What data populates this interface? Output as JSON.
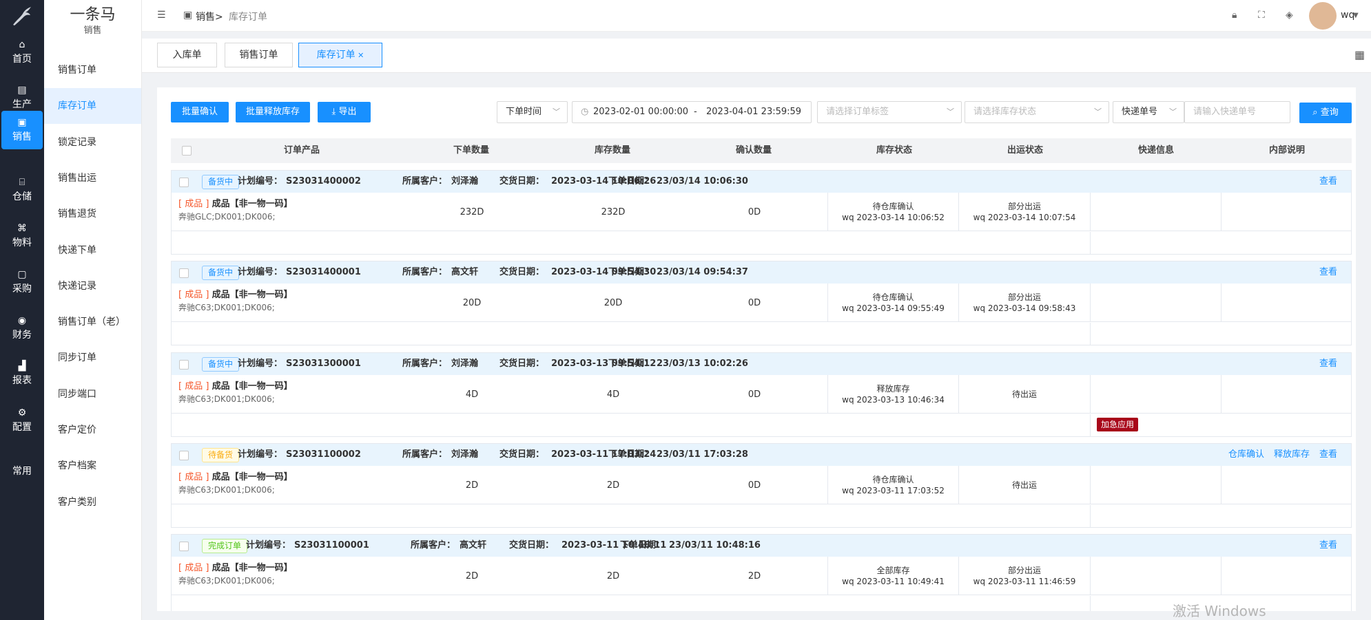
{
  "rail": [
    {
      "icon": "⌂",
      "label": "首页",
      "name": "home"
    },
    {
      "icon": "▤",
      "label": "生产",
      "name": "production"
    },
    {
      "icon": "▣",
      "label": "销售",
      "name": "sales"
    },
    {
      "icon": "⌸",
      "label": "仓储",
      "name": "warehouse"
    },
    {
      "icon": "⌘",
      "label": "物料",
      "name": "material"
    },
    {
      "icon": "▢",
      "label": "采购",
      "name": "purchase"
    },
    {
      "icon": "◉",
      "label": "财务",
      "name": "finance"
    },
    {
      "icon": "▟",
      "label": "报表",
      "name": "report"
    },
    {
      "icon": "⚙",
      "label": "配置",
      "name": "config"
    },
    {
      "icon": "",
      "label": "常用",
      "name": "common"
    }
  ],
  "brand": {
    "title": "一条马",
    "subtitle": "销售"
  },
  "submenu": [
    "销售订单",
    "库存订单",
    "锁定记录",
    "销售出运",
    "销售退货",
    "快递下单",
    "快递记录",
    "销售订单（老）",
    "同步订单",
    "同步端口",
    "客户定价",
    "客户档案",
    "客户类别"
  ],
  "breadcrumb": {
    "root": "销售>",
    "current": "库存订单"
  },
  "user": {
    "name": "wq"
  },
  "tabs": [
    "入库单",
    "销售订单",
    "库存订单"
  ],
  "toolbar": {
    "batch_confirm": "批量确认",
    "batch_release": "批量释放库存",
    "export": "导出",
    "time_type": "下单时间",
    "date_start": "2023-02-01 00:00:00",
    "date_sep": "-",
    "date_end": "2023-04-01 23:59:59",
    "order_tag_ph": "请选择订单标签",
    "stock_status_ph": "请选择库存状态",
    "express_field": "快递单号",
    "express_ph": "请输入快递单号",
    "query": "查询"
  },
  "columns": [
    "订单产品",
    "下单数量",
    "库存数量",
    "确认数量",
    "库存状态",
    "出运状态",
    "快递信息",
    "内部说明"
  ],
  "labels": {
    "plan_no": "计划编号：",
    "customer": "所属客户：",
    "delivery": "交货日期：",
    "order_date": "下单日期：",
    "view": "查看",
    "wh_confirm": "仓库确认",
    "release": "释放库存"
  },
  "orders": [
    {
      "status": "备货中",
      "status_color": "blue",
      "plan_no": "S23031400002",
      "customer": "刘泽瀚",
      "delivery": "2023-03-14 10:06:26",
      "order_date": "23/03/14 10:06:30",
      "cat": "[ 成品 ]",
      "name": "成品【非一物一码】",
      "sku": "奔驰GLC;DK001;DK006;",
      "qty": "232D",
      "stock": "232D",
      "confirm": "0D",
      "stock_status": "待仓库确认",
      "stock_time": "wq 2023-03-14 10:06:52",
      "ship_status": "部分出运",
      "ship_time": "wq 2023-03-14 10:07:54",
      "urgent": "",
      "actions": [
        "查看"
      ]
    },
    {
      "status": "备货中",
      "status_color": "blue",
      "plan_no": "S23031400001",
      "customer": "高文轩",
      "delivery": "2023-03-14 09:54:30",
      "order_date": "23/03/14 09:54:37",
      "cat": "[ 成品 ]",
      "name": "成品【非一物一码】",
      "sku": "奔驰C63;DK001;DK006;",
      "qty": "20D",
      "stock": "20D",
      "confirm": "0D",
      "stock_status": "待仓库确认",
      "stock_time": "wq 2023-03-14 09:55:49",
      "ship_status": "部分出运",
      "ship_time": "wq 2023-03-14 09:58:43",
      "urgent": "",
      "actions": [
        "查看"
      ]
    },
    {
      "status": "备货中",
      "status_color": "blue",
      "plan_no": "S23031300001",
      "customer": "刘泽瀚",
      "delivery": "2023-03-13 09:54:12",
      "order_date": "23/03/13 10:02:26",
      "cat": "[ 成品 ]",
      "name": "成品【非一物一码】",
      "sku": "奔驰C63;DK001;DK006;",
      "qty": "4D",
      "stock": "4D",
      "confirm": "0D",
      "stock_status": "释放库存",
      "stock_time": "wq 2023-03-13 10:46:34",
      "ship_status": "待出运",
      "ship_time": "",
      "urgent": "加急应用",
      "actions": [
        "查看"
      ]
    },
    {
      "status": "待备货",
      "status_color": "yellow",
      "plan_no": "S23031100002",
      "customer": "刘泽瀚",
      "delivery": "2023-03-11 17:03:24",
      "order_date": "23/03/11 17:03:28",
      "cat": "[ 成品 ]",
      "name": "成品【非一物一码】",
      "sku": "奔驰C63;DK001;DK006;",
      "qty": "2D",
      "stock": "2D",
      "confirm": "0D",
      "stock_status": "待仓库确认",
      "stock_time": "wq 2023-03-11 17:03:52",
      "ship_status": "待出运",
      "ship_time": "",
      "urgent": "",
      "actions": [
        "仓库确认",
        "释放库存",
        "查看"
      ]
    },
    {
      "status": "完成订单",
      "status_color": "green",
      "plan_no": "S23031100001",
      "customer": "高文轩",
      "delivery": "2023-03-11 10:48:11",
      "order_date": "23/03/11 10:48:16",
      "cat": "[ 成品 ]",
      "name": "成品【非一物一码】",
      "sku": "奔驰C63;DK001;DK006;",
      "qty": "2D",
      "stock": "2D",
      "confirm": "2D",
      "stock_status": "全部库存",
      "stock_time": "wq 2023-03-11 10:49:41",
      "ship_status": "部分出运",
      "ship_time": "wq 2023-03-11 11:46:59",
      "urgent": "",
      "actions": [
        "查看"
      ]
    }
  ],
  "watermark": "激活 Windows",
  "colors": {
    "primary": "#1890ff",
    "rail": "#1f2532",
    "urgent": "#a8071a",
    "category": "#f5562a"
  }
}
